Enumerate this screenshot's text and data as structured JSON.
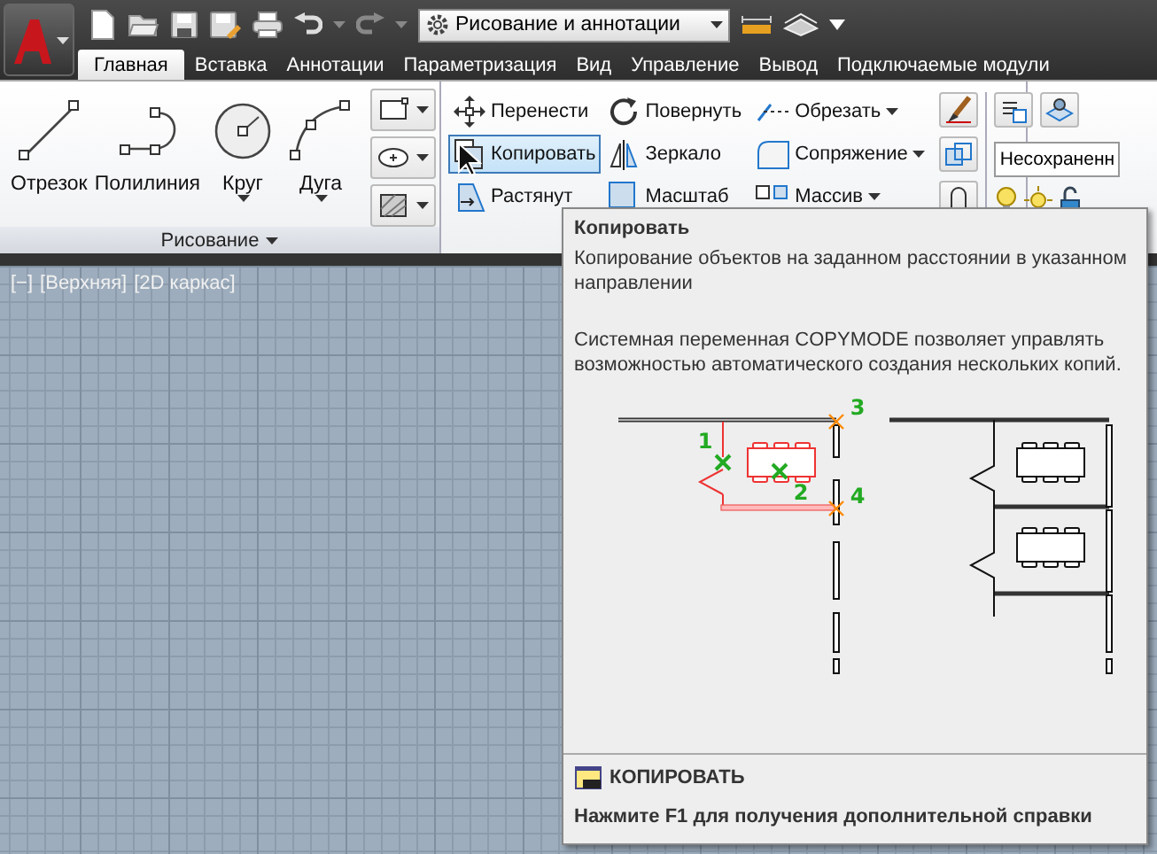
{
  "quick_access": {
    "workspace": "Рисование и аннотации"
  },
  "tabs": [
    {
      "label": "Главная",
      "selected": true
    },
    {
      "label": "Вставка",
      "selected": false
    },
    {
      "label": "Аннотации",
      "selected": false
    },
    {
      "label": "Параметризация",
      "selected": false
    },
    {
      "label": "Вид",
      "selected": false
    },
    {
      "label": "Управление",
      "selected": false
    },
    {
      "label": "Вывод",
      "selected": false
    },
    {
      "label": "Подключаемые модули",
      "selected": false
    }
  ],
  "draw_panel": {
    "title": "Рисование",
    "tools": [
      {
        "label": "Отрезок",
        "has_menu": false
      },
      {
        "label": "Полилиния",
        "has_menu": false
      },
      {
        "label": "Круг",
        "has_menu": true
      },
      {
        "label": "Дуга",
        "has_menu": true
      }
    ]
  },
  "modify_panel": {
    "columns": [
      [
        {
          "label": "Перенести",
          "selected": false,
          "has_menu": false
        },
        {
          "label": "Копировать",
          "selected": true,
          "has_menu": false
        },
        {
          "label": "Растянут",
          "selected": false,
          "has_menu": false
        }
      ],
      [
        {
          "label": "Повернуть",
          "selected": false,
          "has_menu": false
        },
        {
          "label": "Зеркало",
          "selected": false,
          "has_menu": false
        },
        {
          "label": "Масштаб",
          "selected": false,
          "has_menu": false
        }
      ],
      [
        {
          "label": "Обрезать",
          "selected": false,
          "has_menu": true
        },
        {
          "label": "Сопряжение",
          "selected": false,
          "has_menu": true
        },
        {
          "label": "Массив",
          "selected": false,
          "has_menu": true
        }
      ]
    ]
  },
  "layers_panel": {
    "layer_state": "Несохраненн"
  },
  "viewport": {
    "controls": [
      "[−]",
      "[Верхняя]",
      "[2D каркас]"
    ]
  },
  "tooltip": {
    "title": "Копировать",
    "description": "Копирование объектов на заданном расстоянии в указанном направлении",
    "note": "Системная переменная COPYMODE позволяет управлять возможностью автоматического создания нескольких копий.",
    "figure_labels": [
      "1",
      "2",
      "3",
      "4"
    ],
    "command": "КОПИРОВАТЬ",
    "help": "Нажмите F1 для получения дополнительной справки"
  }
}
